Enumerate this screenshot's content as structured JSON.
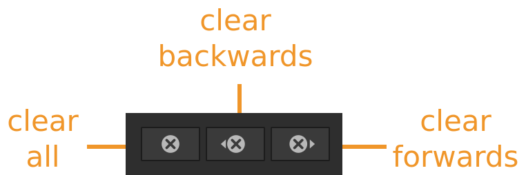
{
  "callouts": {
    "clear_all": [
      "clear",
      "all"
    ],
    "clear_backwards": [
      "clear",
      "backwards"
    ],
    "clear_forwards": [
      "clear",
      "forwards"
    ]
  },
  "toolbar": {
    "buttons": [
      {
        "name": "clear-all",
        "icon": "x-circle-icon"
      },
      {
        "name": "clear-backwards",
        "icon": "x-circle-left-arrow-icon"
      },
      {
        "name": "clear-forwards",
        "icon": "x-circle-right-arrow-icon"
      }
    ]
  },
  "colors": {
    "accent": "#f0962a",
    "toolbar_bg": "#2e2e2e",
    "button_bg": "#3a3a3a",
    "icon": "#b8b8b8"
  }
}
